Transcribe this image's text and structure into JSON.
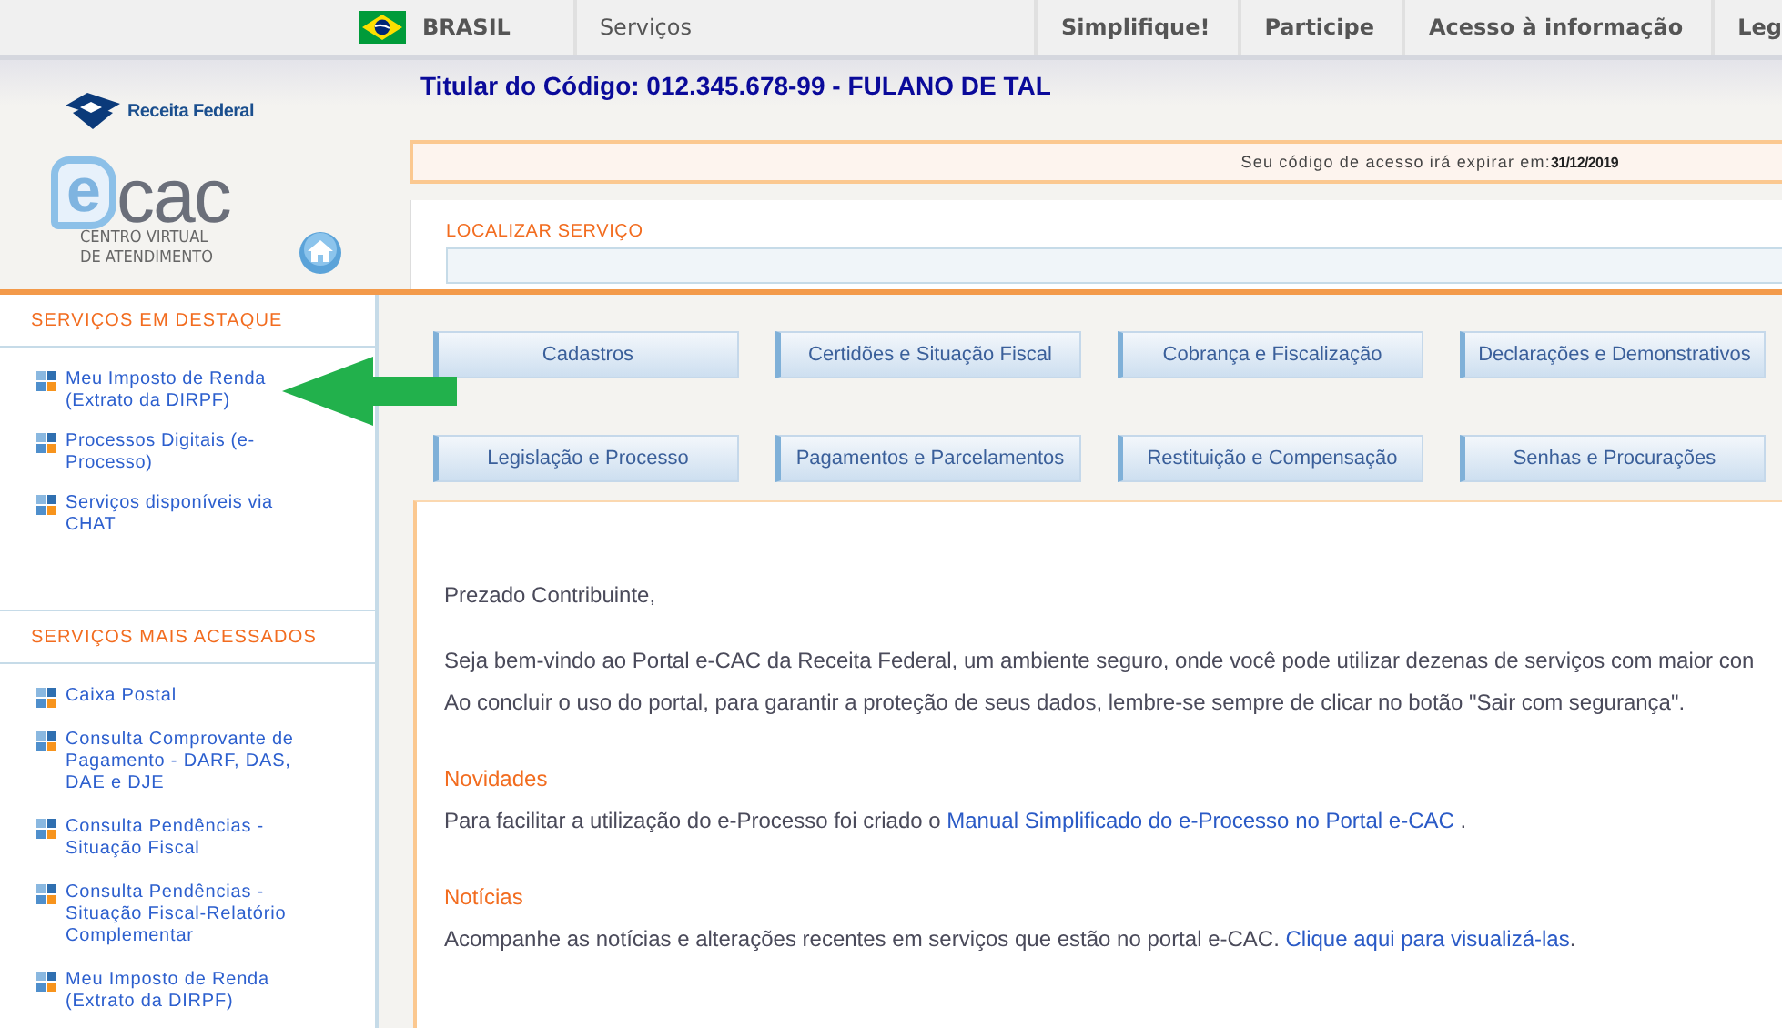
{
  "top_bar": {
    "country": "BRASIL",
    "links": [
      "Serviços"
    ],
    "right_links": [
      "Simplifique!",
      "Participe",
      "Acesso à informação",
      "Leg"
    ]
  },
  "logo": {
    "agency": "Receita Federal",
    "mark_letter": "e",
    "mark_text": "cac",
    "subtitle_lines": [
      "CENTRO VIRTUAL",
      "DE ATENDIMENTO"
    ]
  },
  "header": {
    "title": "Titular do Código: 012.345.678-99 - FULANO DE TAL",
    "expiry_notice": "Seu código de acesso irá expirar em:",
    "expiry_date": "31/12/2019",
    "search_label": "LOCALIZAR SERVIÇO"
  },
  "sidebar": {
    "sections": [
      {
        "title": "SERVIÇOS EM DESTAQUE",
        "items": [
          "Meu Imposto de Renda (Extrato da DIRPF)",
          "Processos Digitais (e-Processo)",
          "Serviços disponíveis via CHAT"
        ]
      },
      {
        "title": "SERVIÇOS MAIS ACESSADOS",
        "items": [
          "Caixa Postal",
          "Consulta Comprovante de Pagamento - DARF, DAS, DAE e DJE",
          "Consulta Pendências - Situação Fiscal",
          "Consulta Pendências - Situação Fiscal-Relatório Complementar",
          "Meu Imposto de Renda (Extrato da DIRPF)"
        ]
      }
    ]
  },
  "service_buttons": [
    "Cadastros",
    "Certidões e Situação Fiscal",
    "Cobrança e Fiscalização",
    "Declarações e Demonstrativos",
    "Legislação e Processo",
    "Pagamentos e Parcelamentos",
    "Restituição e Compensação",
    "Senhas e Procurações"
  ],
  "content": {
    "greeting": "Prezado Contribuinte,",
    "paragraphs": [
      "Seja bem-vindo ao Portal e-CAC da Receita Federal, um ambiente seguro, onde você pode utilizar dezenas de serviços com maior con",
      "Ao concluir o uso do portal, para garantir a proteção de seus dados, lembre-se sempre de clicar no botão \"Sair com segurança\"."
    ],
    "sections": [
      {
        "title": "Novidades",
        "text": "Para facilitar a utilização do e-Processo foi criado o ",
        "link": "Manual Simplificado do e-Processo no Portal e-CAC",
        "after": " ."
      },
      {
        "title": "Notícias",
        "text": "Acompanhe as notícias e alterações recentes em serviços que estão no portal e-CAC. ",
        "link": "Clique aqui para visualizá-las",
        "after": "."
      }
    ]
  }
}
